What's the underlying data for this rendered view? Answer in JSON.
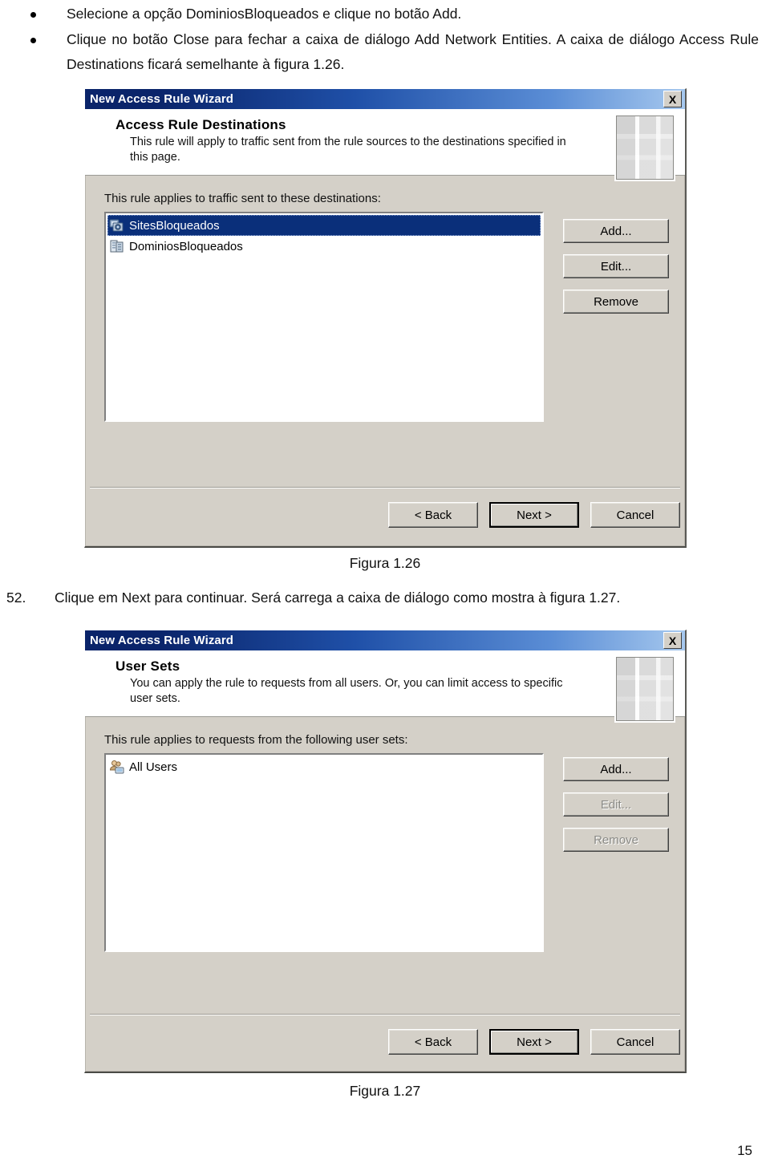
{
  "document": {
    "bullets": [
      "Selecione a opção DominiosBloqueados e clique no botão Add.",
      "Clique no botão Close para fechar a caixa de diálogo Add Network Entities. A caixa de diálogo Access Rule Destinations ficará semelhante à figura 1.26."
    ],
    "figure1_caption": "Figura 1.26",
    "step": {
      "number": "52.",
      "text": "Clique em Next para continuar. Será carrega a caixa de diálogo como mostra à figura 1.27."
    },
    "figure2_caption": "Figura 1.27",
    "page_number": "15"
  },
  "dialog1": {
    "title": "New Access Rule Wizard",
    "close_label": "X",
    "header": {
      "heading": "Access Rule Destinations",
      "description": "This rule will apply to traffic sent from the rule sources to the destinations specified in this page."
    },
    "body_label": "This rule applies to traffic sent to these destinations:",
    "list": [
      {
        "label": "SitesBloqueados",
        "icon": "network-computer-icon",
        "selected": true
      },
      {
        "label": "DominiosBloqueados",
        "icon": "domain-set-icon",
        "selected": false
      }
    ],
    "side_buttons": [
      {
        "label": "Add...",
        "accel": "A",
        "disabled": false
      },
      {
        "label": "Edit...",
        "accel": "E",
        "disabled": false
      },
      {
        "label": "Remove",
        "accel": "R",
        "disabled": false
      }
    ],
    "bottom_buttons": [
      {
        "label": "< Back",
        "accel": "B",
        "default": false
      },
      {
        "label": "Next >",
        "accel": "N",
        "default": true
      },
      {
        "label": "Cancel",
        "accel": "",
        "default": false
      }
    ]
  },
  "dialog2": {
    "title": "New Access Rule Wizard",
    "close_label": "X",
    "header": {
      "heading": "User Sets",
      "description": "You can apply the rule to requests from all users. Or, you can limit access to specific user sets."
    },
    "body_label": "This rule applies to requests from the following user sets:",
    "list": [
      {
        "label": "All Users",
        "icon": "users-icon",
        "selected": false
      }
    ],
    "side_buttons": [
      {
        "label": "Add...",
        "accel": "A",
        "disabled": false
      },
      {
        "label": "Edit...",
        "accel": "E",
        "disabled": true
      },
      {
        "label": "Remove",
        "accel": "R",
        "disabled": true
      }
    ],
    "bottom_buttons": [
      {
        "label": "< Back",
        "accel": "B",
        "default": false
      },
      {
        "label": "Next >",
        "accel": "N",
        "default": true
      },
      {
        "label": "Cancel",
        "accel": "",
        "default": false
      }
    ]
  },
  "colors": {
    "titlebar_dark": "#0a246a",
    "titlebar_light": "#a6c8ee",
    "dialog_face": "#d4d0c8",
    "selection": "#0a2f7a"
  }
}
